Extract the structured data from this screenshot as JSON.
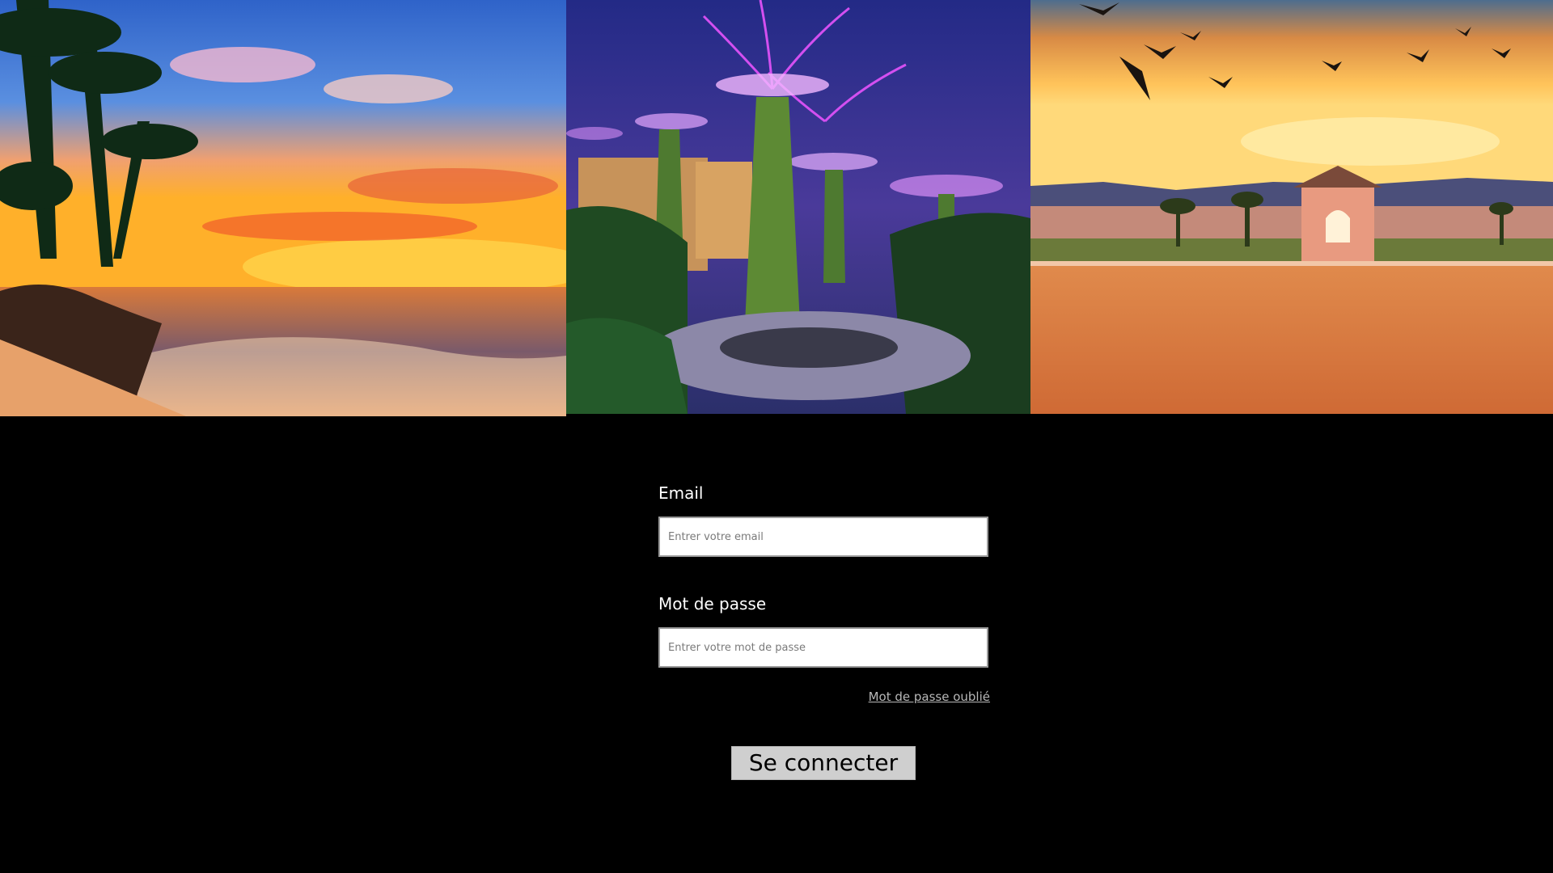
{
  "form": {
    "email_label": "Email",
    "email_placeholder": "Entrer votre email",
    "password_label": "Mot de passe",
    "password_placeholder": "Entrer votre mot de passe",
    "forgot_link": "Mot de passe oublié",
    "submit_label": "Se connecter"
  },
  "colors": {
    "page_background": "#000000",
    "label_text": "#ffffff",
    "button_background": "#cfcfcf",
    "link_text": "#b8b8b8"
  }
}
